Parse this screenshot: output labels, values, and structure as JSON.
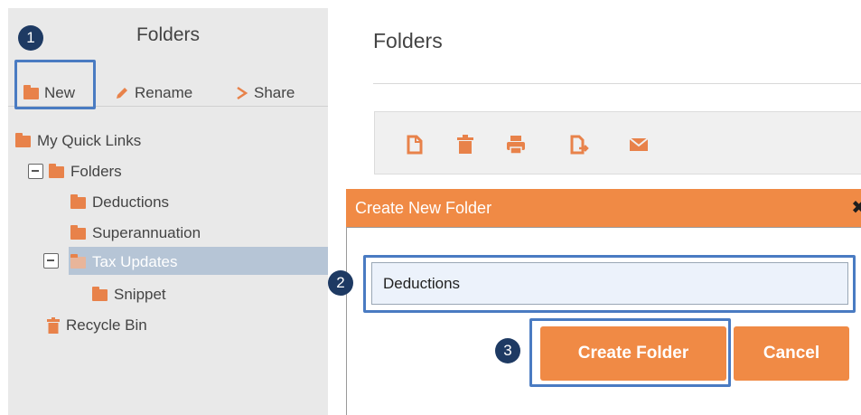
{
  "left_panel": {
    "title": "Folders",
    "toolbar": {
      "new_label": "New",
      "rename_label": "Rename",
      "share_label": "Share"
    },
    "tree": {
      "quick_links": "My Quick Links",
      "folders": "Folders",
      "deductions": "Deductions",
      "superannuation": "Superannuation",
      "tax_updates": "Tax Updates",
      "snippet": "Snippet",
      "recycle_bin": "Recycle Bin"
    }
  },
  "main": {
    "title": "Folders",
    "actions": [
      "new-document-icon",
      "trash-icon",
      "print-icon",
      "export-icon",
      "email-icon"
    ]
  },
  "dialog": {
    "title": "Create New Folder",
    "close_label": "✖",
    "folder_name_value": "Deductions",
    "create_label": "Create Folder",
    "cancel_label": "Cancel"
  },
  "steps": {
    "step1": "1",
    "step2": "2",
    "step3": "3"
  },
  "colors": {
    "accent": "#f08a45",
    "highlight": "#4a7bc2",
    "badge": "#1e3a63",
    "selected": "#b6c5d6"
  }
}
